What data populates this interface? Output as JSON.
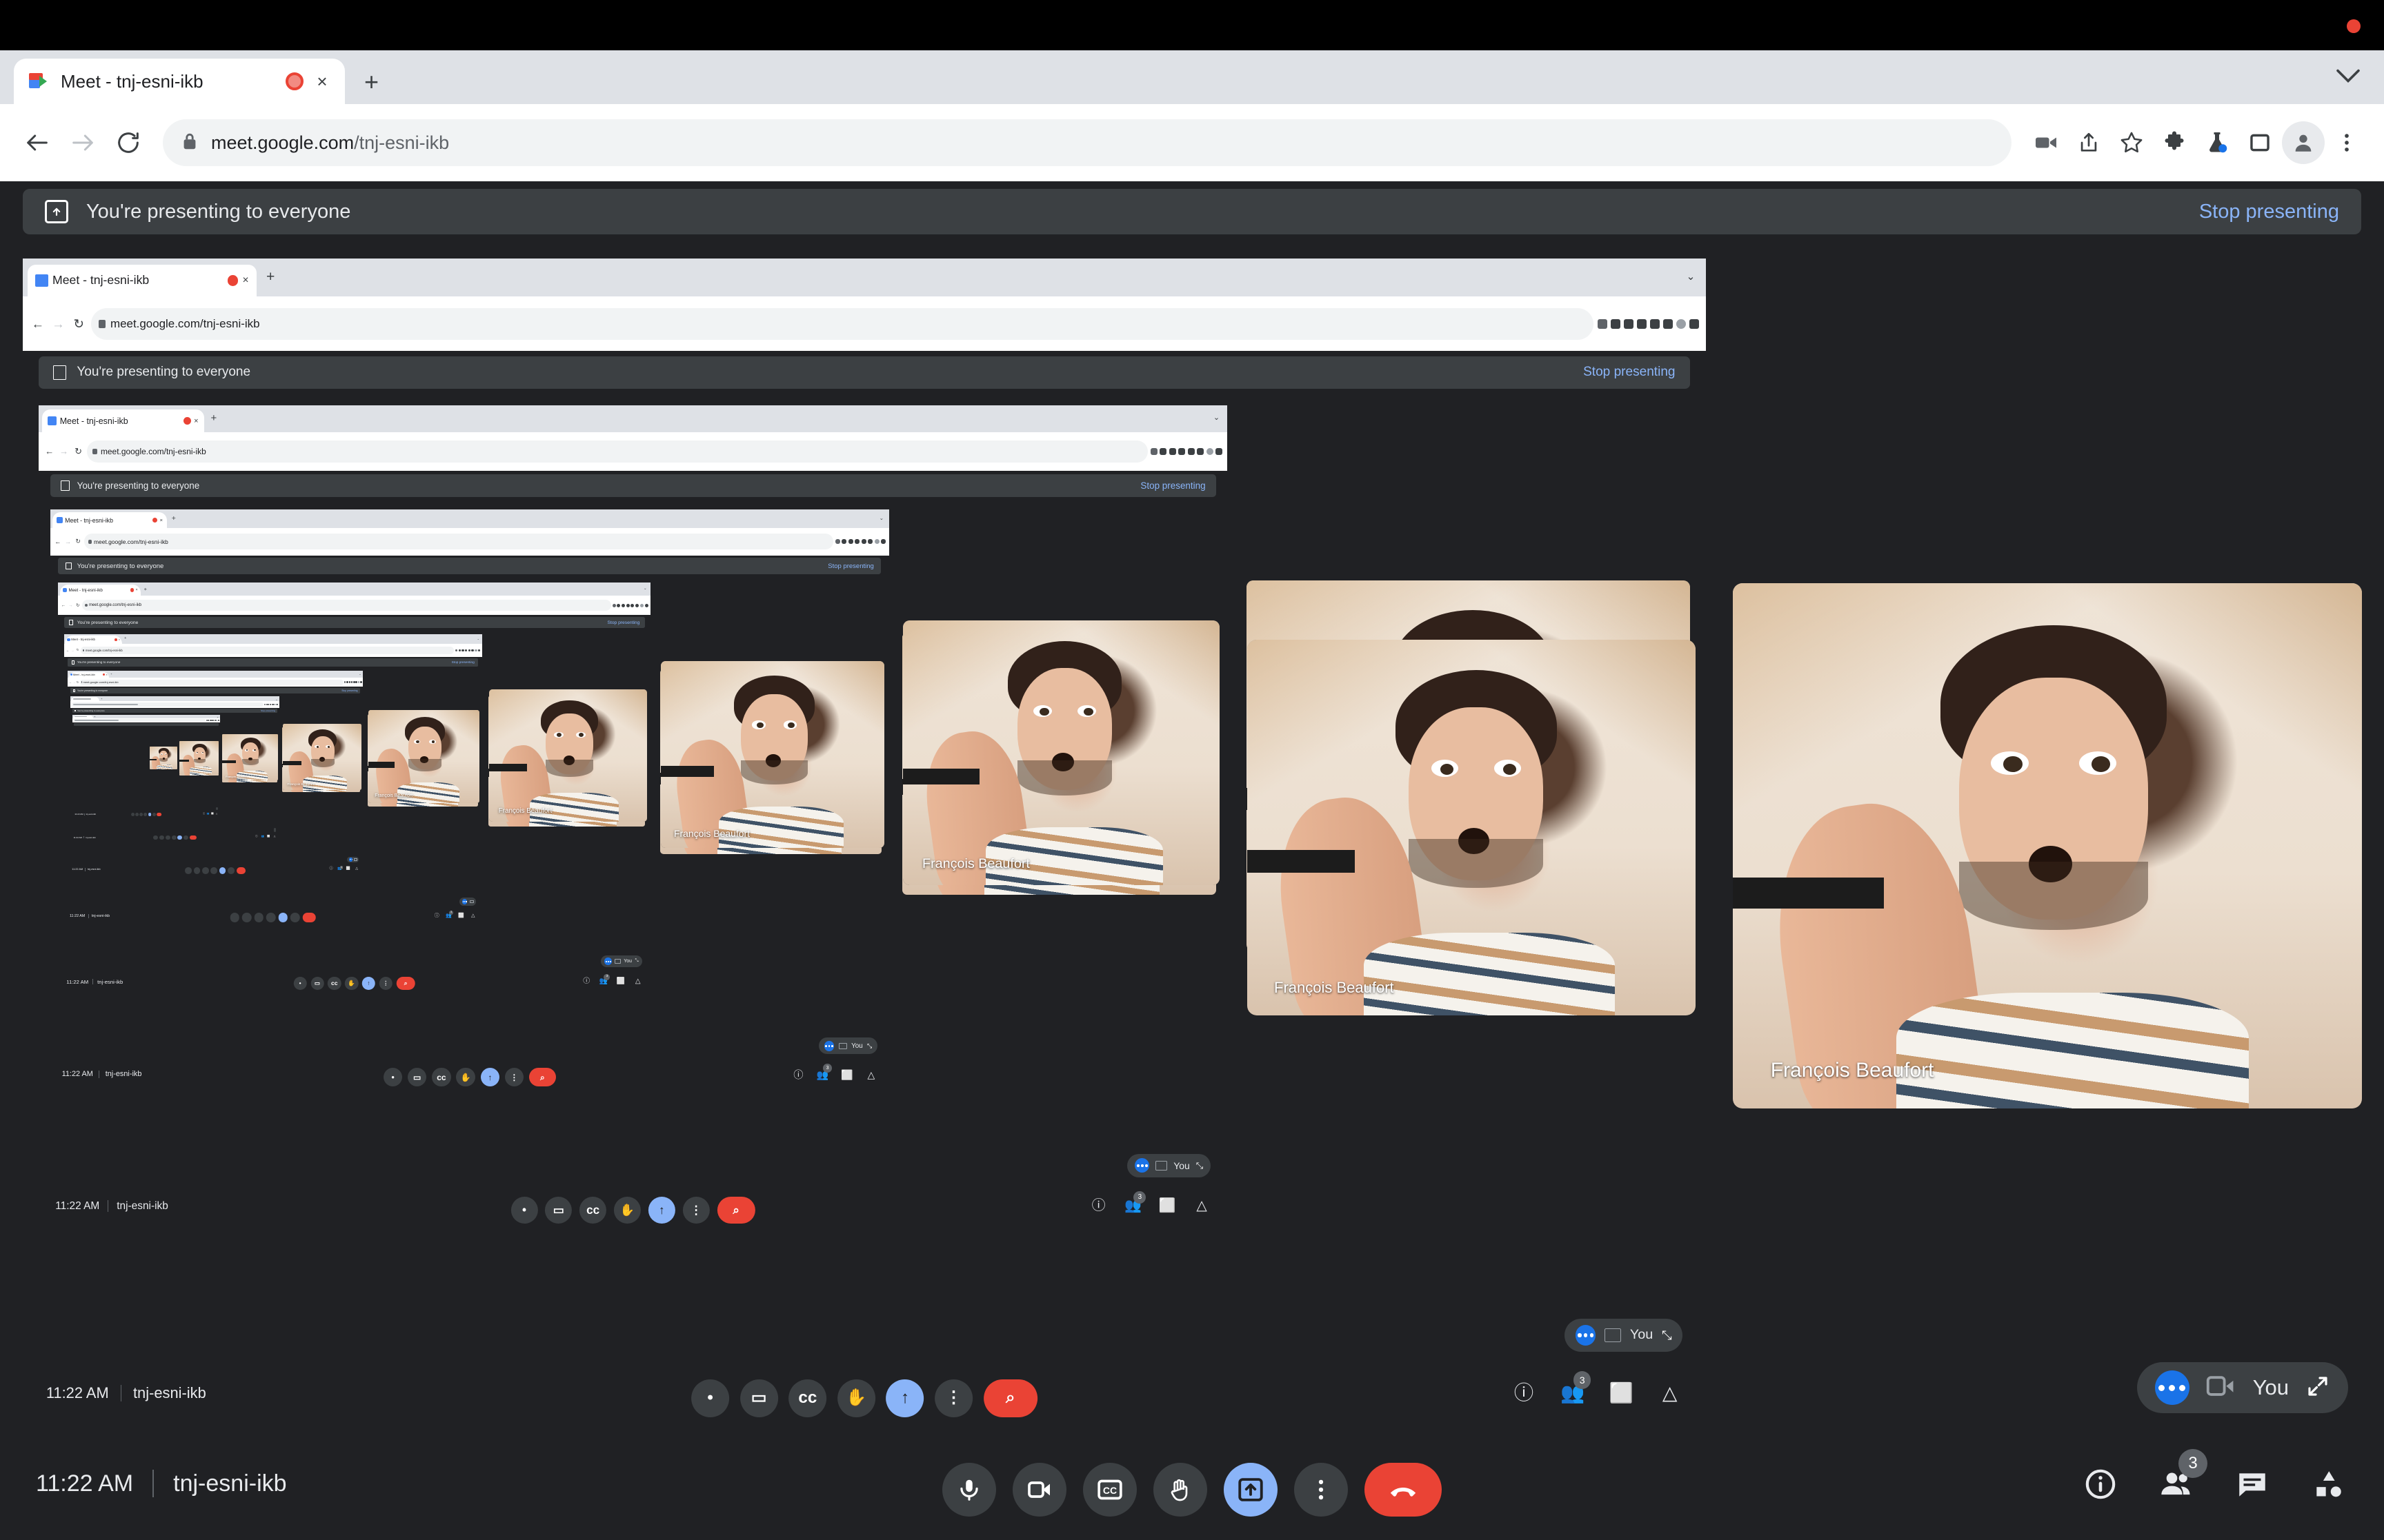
{
  "browser": {
    "tab": {
      "title": "Meet - tnj-esni-ikb",
      "favicon": "meet-icon",
      "recording_indicator": "recording-dot",
      "close": "×"
    },
    "new_tab": "+",
    "tabstrip_chevron": "chevron-down-icon",
    "nav": {
      "back": "back-arrow-icon",
      "forward": "forward-arrow-icon",
      "reload": "reload-icon"
    },
    "omnibox": {
      "lock": "lock-icon",
      "url_domain": "meet.google.com",
      "url_path": "/tnj-esni-ikb"
    },
    "actions": [
      {
        "name": "media-cast-icon",
        "glyph": "videocam"
      },
      {
        "name": "share-icon",
        "glyph": "share"
      },
      {
        "name": "bookmark-star-icon",
        "glyph": "star"
      },
      {
        "name": "extensions-puzzle-icon",
        "glyph": "puzzle"
      },
      {
        "name": "experiments-flask-icon",
        "glyph": "flask"
      },
      {
        "name": "side-panel-icon",
        "glyph": "panel"
      },
      {
        "name": "profile-avatar",
        "glyph": "person"
      },
      {
        "name": "chrome-menu-icon",
        "glyph": "kebab"
      }
    ]
  },
  "meet": {
    "banner": {
      "icon": "present-screen-icon",
      "text": "You're presenting to everyone",
      "stop_label": "Stop presenting"
    },
    "bottom_bar": {
      "time": "11:22 AM",
      "meeting_code": "tnj-esni-ikb",
      "controls": [
        {
          "name": "microphone-button",
          "icon": "mic",
          "state": "on"
        },
        {
          "name": "camera-button",
          "icon": "videocam",
          "state": "on"
        },
        {
          "name": "captions-button",
          "icon": "cc",
          "state": "off"
        },
        {
          "name": "raise-hand-button",
          "icon": "hand",
          "state": "off"
        },
        {
          "name": "present-now-button",
          "icon": "present",
          "state": "active"
        },
        {
          "name": "more-options-button",
          "icon": "kebab",
          "state": "off"
        },
        {
          "name": "end-call-button",
          "icon": "call-end",
          "state": "end"
        }
      ],
      "right_controls": [
        {
          "name": "meeting-details-button",
          "icon": "info",
          "badge": ""
        },
        {
          "name": "participants-button",
          "icon": "people",
          "badge": "3"
        },
        {
          "name": "chat-button",
          "icon": "chat",
          "badge": ""
        },
        {
          "name": "activities-button",
          "icon": "activities",
          "badge": ""
        }
      ]
    },
    "self_pill": {
      "status_icon": "speaking-dots-icon",
      "camera_icon": "videocam-outline-icon",
      "label": "You",
      "expand_icon": "expand-arrows-icon"
    },
    "participant_name": "François Beaufort",
    "tiles": [
      {
        "name": "participant-tile-large",
        "label": "François Beaufort"
      },
      {
        "name": "participant-tile-medium",
        "label": "François Beaufort"
      },
      {
        "name": "participant-tile-small",
        "label": "François Beaufort"
      },
      {
        "name": "participant-tile-xsmall",
        "label": "François Beaufort"
      },
      {
        "name": "participant-tile-xxsmall",
        "label": "François Beaufort"
      }
    ],
    "recursion_depth": 7
  },
  "colors": {
    "meet_background": "#202124",
    "banner_background": "#3c4043",
    "accent_blue": "#8ab4f8",
    "link_blue": "#8ab4f8",
    "end_call_red": "#ea4335",
    "chrome_tabstrip": "#dee1e6",
    "speaking_blue": "#1a73e8"
  }
}
